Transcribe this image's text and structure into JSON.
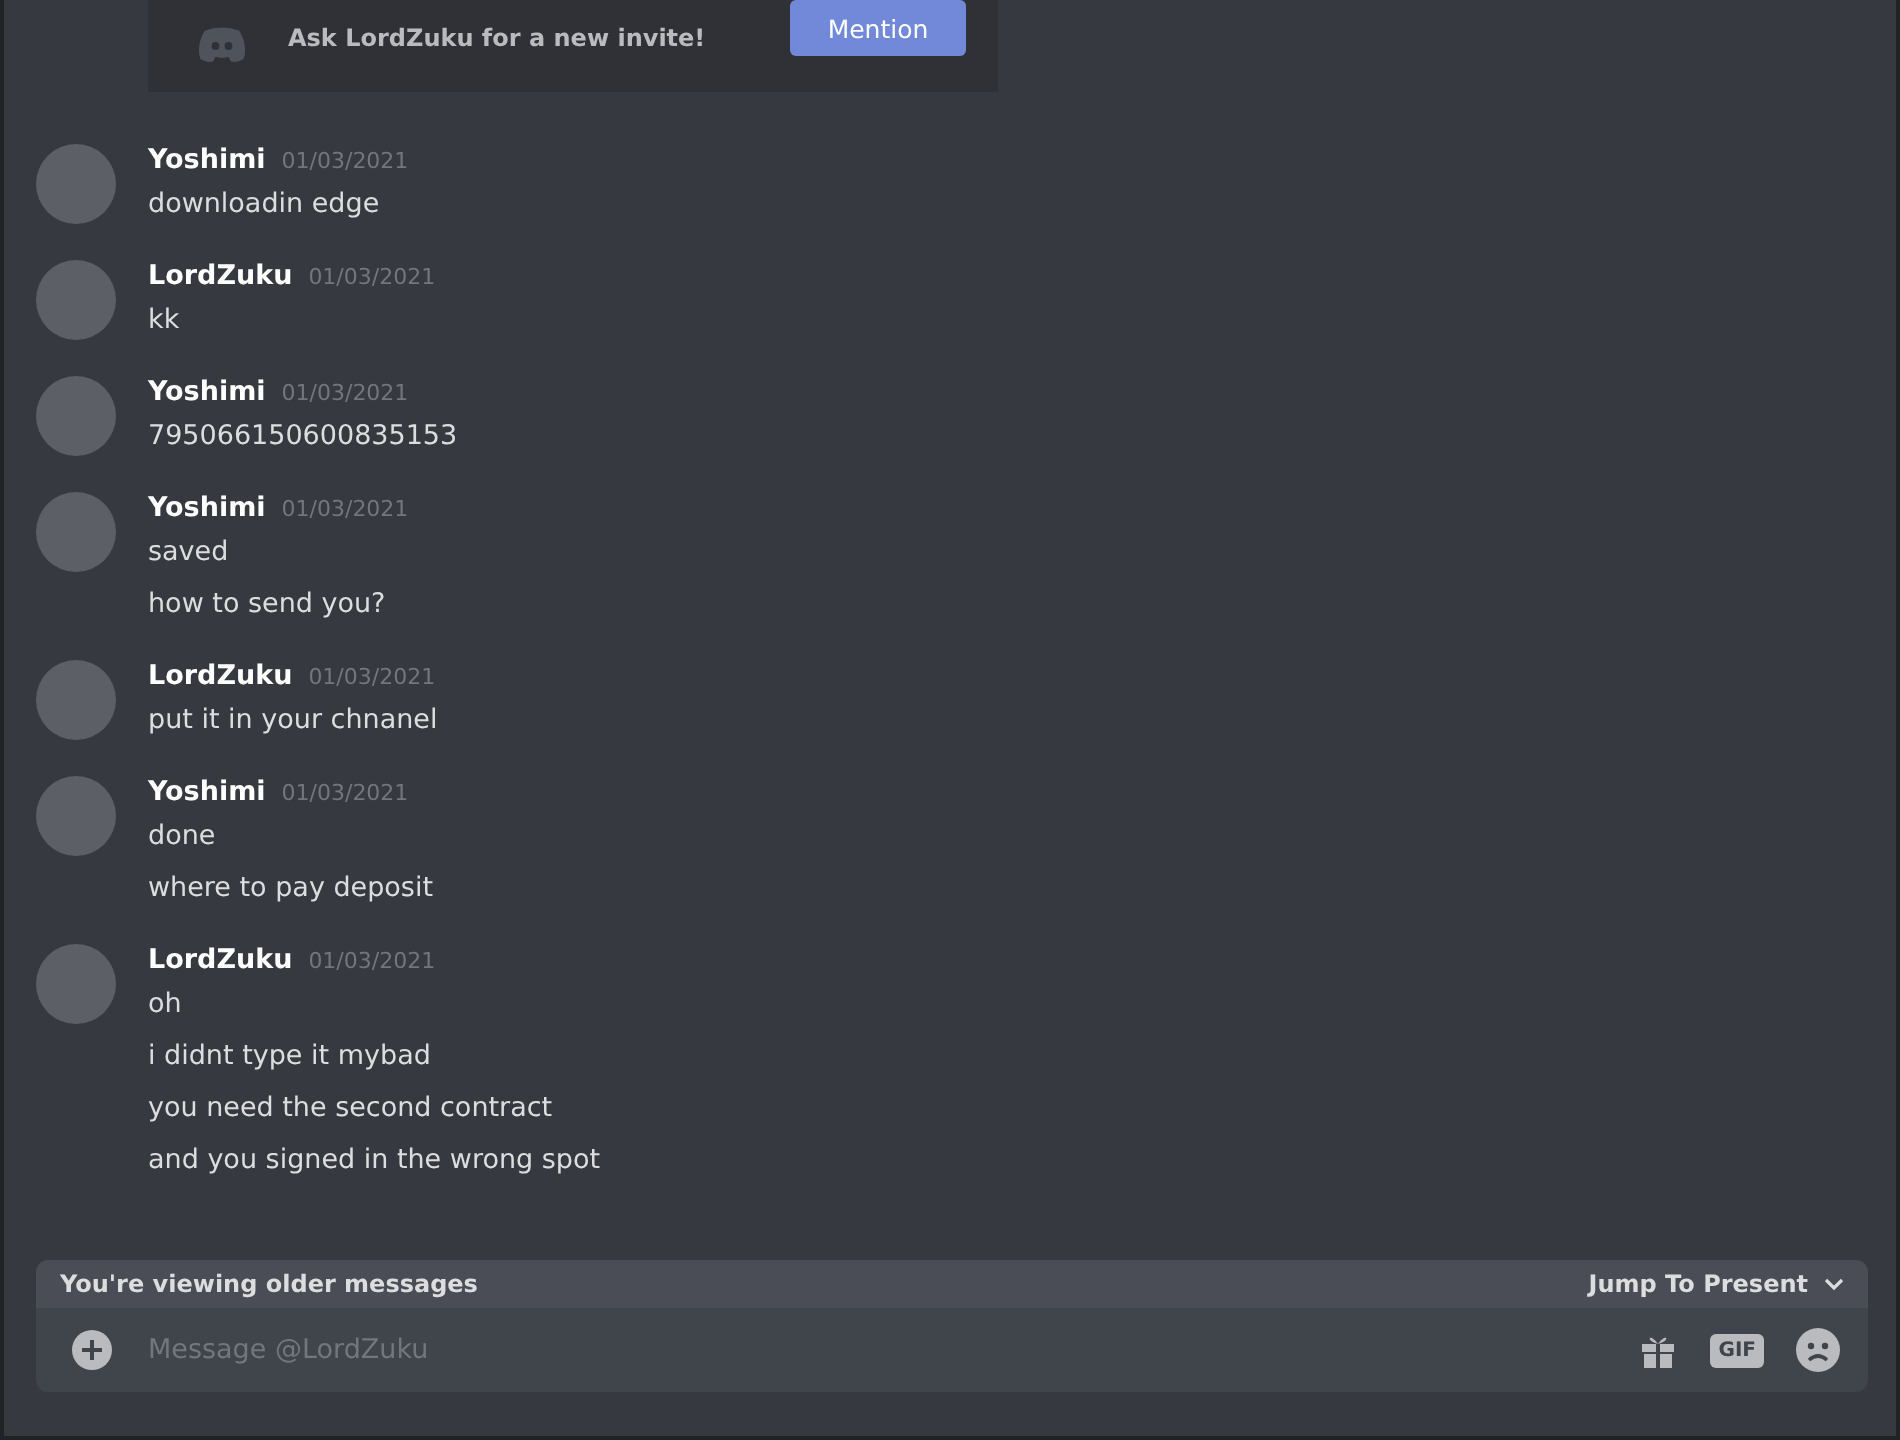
{
  "invite": {
    "text": "Ask LordZuku for a new invite!",
    "button": "Mention"
  },
  "messages": [
    {
      "author": "Yoshimi",
      "time": "01/03/2021",
      "lines": [
        "downloadin edge"
      ]
    },
    {
      "author": "LordZuku",
      "time": "01/03/2021",
      "lines": [
        "kk"
      ]
    },
    {
      "author": "Yoshimi",
      "time": "01/03/2021",
      "lines": [
        "795066150600835153"
      ]
    },
    {
      "author": "Yoshimi",
      "time": "01/03/2021",
      "lines": [
        "saved",
        "how to send you?"
      ]
    },
    {
      "author": "LordZuku",
      "time": "01/03/2021",
      "lines": [
        "put it in your chnanel"
      ]
    },
    {
      "author": "Yoshimi",
      "time": "01/03/2021",
      "lines": [
        "done",
        "where to pay deposit"
      ]
    },
    {
      "author": "LordZuku",
      "time": "01/03/2021",
      "lines": [
        "oh",
        "i didnt type it mybad",
        "you need the second contract",
        "and you signed in the wrong spot"
      ]
    }
  ],
  "older_bar": {
    "text": "You're viewing older messages",
    "action": "Jump To Present"
  },
  "composer": {
    "placeholder": "Message @LordZuku",
    "gif": "GIF"
  }
}
